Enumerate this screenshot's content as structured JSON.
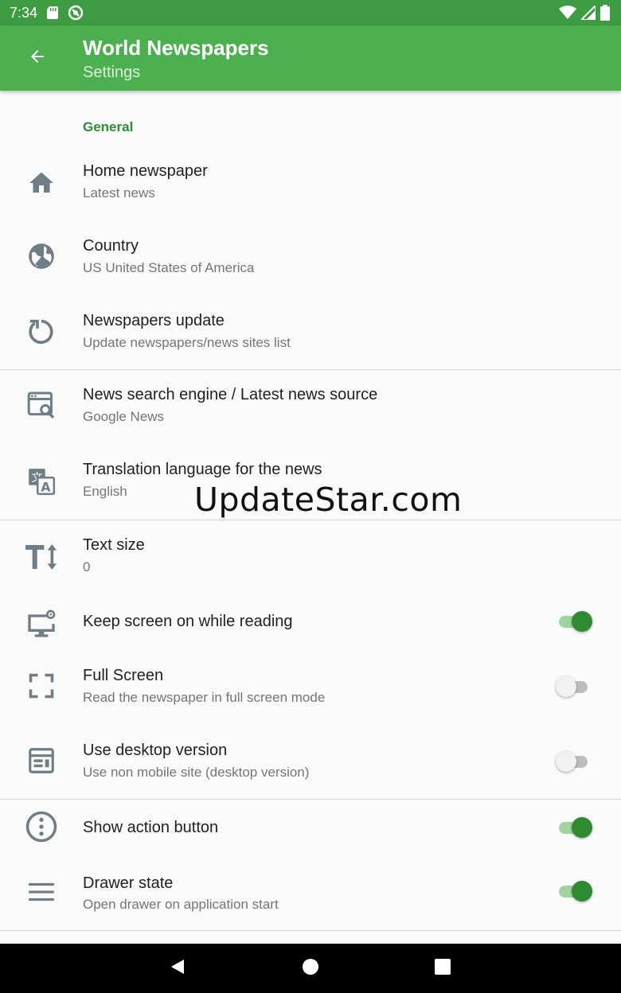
{
  "status_bar": {
    "time": "7:34",
    "icons": [
      "sd-card-icon",
      "vpn-icon",
      "wifi-icon",
      "signal-icon",
      "battery-icon"
    ]
  },
  "app_bar": {
    "title": "World Newspapers",
    "subtitle": "Settings",
    "back_icon": "arrow-back-icon",
    "color": "#4caf50"
  },
  "section": {
    "label": "General"
  },
  "preferences": [
    {
      "title": "Home newspaper",
      "summary": "Latest news",
      "icon": "home-icon"
    },
    {
      "title": "Country",
      "summary": "US United States of America",
      "icon": "globe-icon"
    },
    {
      "title": "Newspapers update",
      "summary": "Update newspapers/news sites list",
      "icon": "refresh-icon"
    },
    {
      "title": "News search engine / Latest news source",
      "summary": "Google News",
      "icon": "search-window-icon"
    },
    {
      "title": "Translation language for the news",
      "summary": "English",
      "icon": "translate-icon"
    },
    {
      "title": "Text size",
      "summary": "0",
      "icon": "text-size-icon"
    },
    {
      "title": "Keep screen on while reading",
      "summary": "",
      "icon": "monitor-icon",
      "switch": true
    },
    {
      "title": "Full Screen",
      "summary": "Read the newspaper in full screen mode",
      "icon": "fullscreen-icon",
      "switch": false
    },
    {
      "title": "Use desktop version",
      "summary": "Use non mobile site (desktop version)",
      "icon": "web-page-icon",
      "switch": false
    },
    {
      "title": "Show action button",
      "summary": "",
      "icon": "more-vert-circle-icon",
      "switch": true
    },
    {
      "title": "Drawer state",
      "summary": "Open drawer on application start",
      "icon": "menu-icon",
      "switch": true
    }
  ],
  "watermark": "UpdateStar.com",
  "nav_bar": {
    "icons": [
      "back-triangle-icon",
      "home-circle-icon",
      "recents-square-icon"
    ]
  },
  "colors": {
    "accent": "#2e8b32",
    "switch_track_on": "#9fd4a1",
    "status_bar": "#3d9b41"
  }
}
